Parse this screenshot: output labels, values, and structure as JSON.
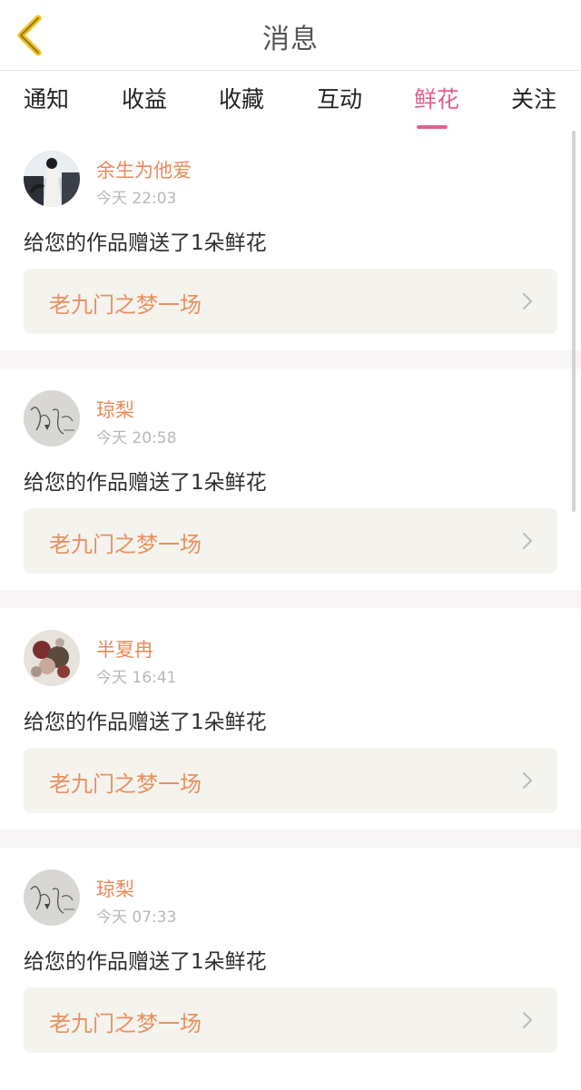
{
  "header": {
    "title": "消息",
    "back_icon": "chevron-left-icon",
    "back_color": "#f2c21b"
  },
  "tabs": [
    {
      "label": "通知",
      "active": false
    },
    {
      "label": "收益",
      "active": false
    },
    {
      "label": "收藏",
      "active": false
    },
    {
      "label": "互动",
      "active": false
    },
    {
      "label": "鲜花",
      "active": true
    },
    {
      "label": "关注",
      "active": false
    }
  ],
  "colors": {
    "accent": "#e0608e",
    "username": "#e9895a",
    "work_title": "#e8915f",
    "timestamp": "#b8b8b8",
    "work_box": "#f4f3ee"
  },
  "messages": [
    {
      "user": "余生为他爱",
      "time": "今天 22:03",
      "text": "给您的作品赠送了1朵鲜花",
      "work": "老九门之梦一场"
    },
    {
      "user": "琼梨",
      "time": "今天 20:58",
      "text": "给您的作品赠送了1朵鲜花",
      "work": "老九门之梦一场"
    },
    {
      "user": "半夏冉",
      "time": "今天 16:41",
      "text": "给您的作品赠送了1朵鲜花",
      "work": "老九门之梦一场"
    },
    {
      "user": "琼梨",
      "time": "今天 07:33",
      "text": "给您的作品赠送了1朵鲜花",
      "work": "老九门之梦一场"
    }
  ]
}
